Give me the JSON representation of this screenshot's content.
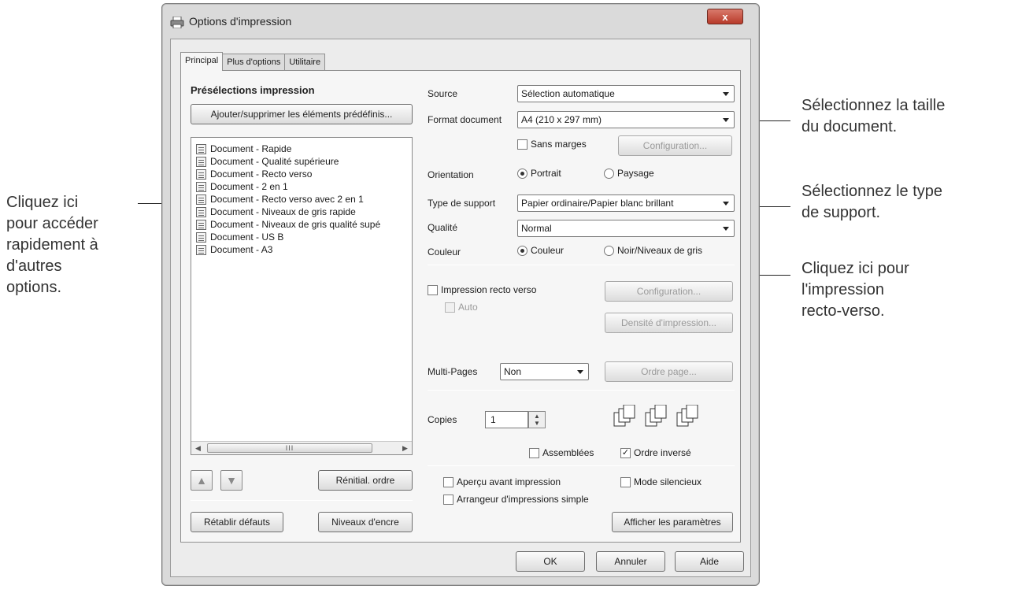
{
  "window": {
    "title": "Options d'impression",
    "close_label": "x"
  },
  "tabs": [
    "Principal",
    "Plus d'options",
    "Utilitaire"
  ],
  "presets": {
    "heading": "Présélections impression",
    "add_remove_button": "Ajouter/supprimer les éléments prédéfinis...",
    "items": [
      "Document - Rapide",
      "Document - Qualité supérieure",
      "Document - Recto verso",
      "Document - 2 en 1",
      "Document - Recto verso avec 2 en 1",
      "Document - Niveaux de gris rapide",
      "Document - Niveaux de gris qualité supé",
      "Document - US B",
      "Document - A3"
    ],
    "scrollbar_thumb": "III",
    "reset_order_button": "Rénitial. ordre",
    "restore_defaults_button": "Rétablir défauts",
    "ink_levels_button": "Niveaux d'encre"
  },
  "settings": {
    "source_label": "Source",
    "source_value": "Sélection automatique",
    "format_label": "Format document",
    "format_value": "A4 (210 x 297 mm)",
    "borderless_label": "Sans marges",
    "config_button_1": "Configuration...",
    "orientation_label": "Orientation",
    "portrait_label": "Portrait",
    "landscape_label": "Paysage",
    "media_label": "Type de support",
    "media_value": "Papier ordinaire/Papier blanc brillant",
    "quality_label": "Qualité",
    "quality_value": "Normal",
    "color_label": "Couleur",
    "color_option": "Couleur",
    "grayscale_option": "Noir/Niveaux de gris",
    "duplex_label": "Impression recto verso",
    "auto_label": "Auto",
    "config_button_2": "Configuration...",
    "density_button": "Densité d'impression...",
    "multipage_label": "Multi-Pages",
    "multipage_value": "Non",
    "page_order_button": "Ordre page...",
    "copies_label": "Copies",
    "copies_value": "1",
    "collate_label": "Assemblées",
    "reverse_label": "Ordre inversé",
    "preview_label": "Aperçu avant impression",
    "quiet_label": "Mode silencieux",
    "arranger_label": "Arrangeur d'impressions simple",
    "show_settings_button": "Afficher les paramètres"
  },
  "footer": {
    "ok": "OK",
    "cancel": "Annuler",
    "help": "Aide"
  },
  "annotations": {
    "left": [
      "Cliquez ici",
      "pour accéder",
      "rapidement à",
      "d'autres",
      "options."
    ],
    "size": [
      "Sélectionnez la taille",
      "du document."
    ],
    "media": [
      "Sélectionnez le type",
      "de support."
    ],
    "duplex": [
      "Cliquez ici pour",
      "l'impression",
      "recto-verso."
    ]
  }
}
